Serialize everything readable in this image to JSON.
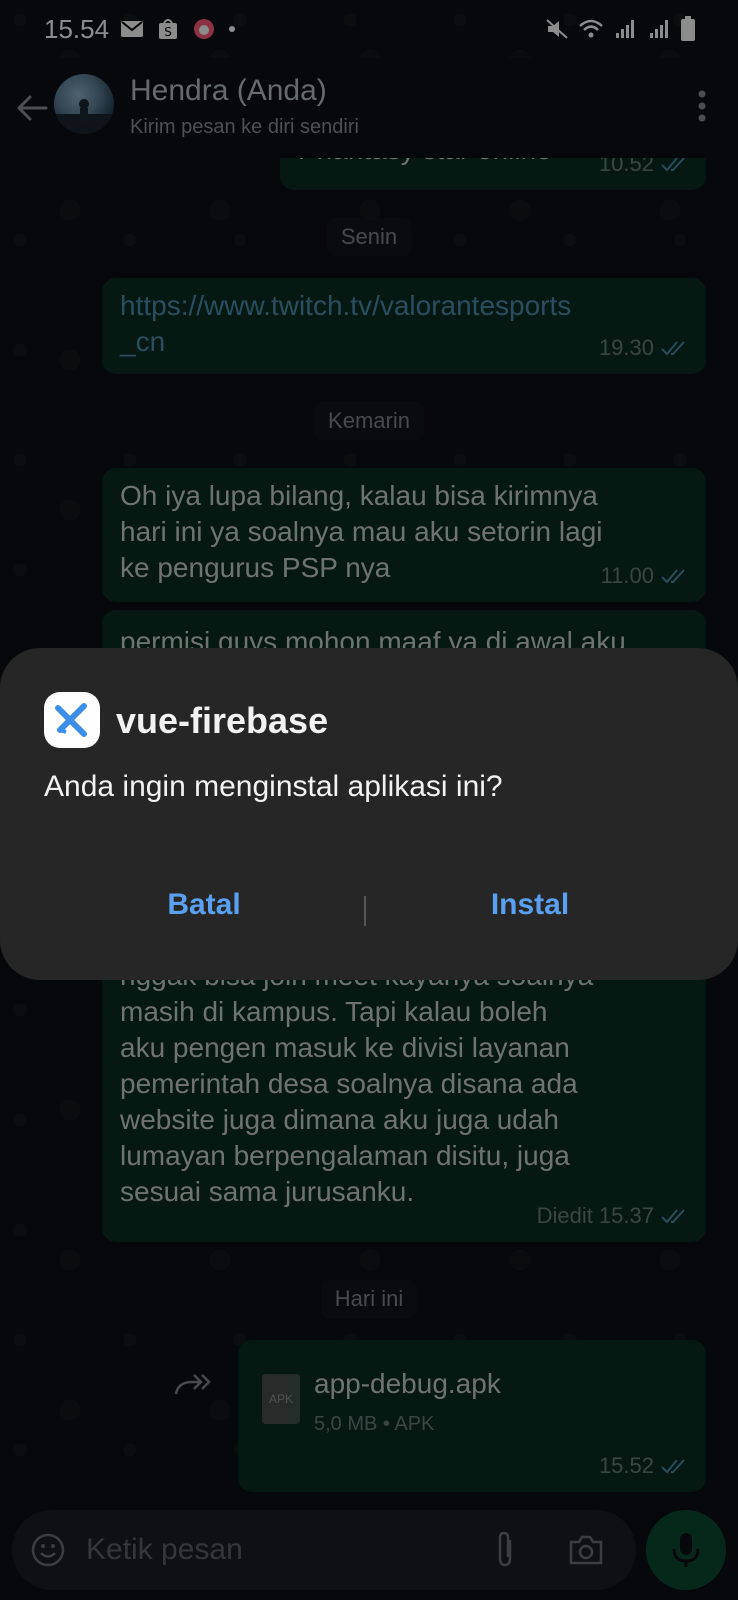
{
  "status_bar": {
    "time": "15.54",
    "notification_icons": [
      "mail-icon",
      "shopee-icon",
      "app-notification-icon",
      "dot-icon"
    ],
    "system_icons": [
      "mute-icon",
      "wifi-icon",
      "signal-icon",
      "signal-icon",
      "battery-icon"
    ]
  },
  "header": {
    "contact_name": "Hendra (Anda)",
    "subtitle": "Kirim pesan ke diri sendiri"
  },
  "messages": {
    "top_partial": {
      "text": "Phantasy star online",
      "time": "10.52"
    },
    "day_senin": "Senin",
    "link": {
      "line1": "https://www.twitch.tv/valorantesports",
      "line2": "_cn",
      "time": "19.30"
    },
    "day_kemarin": "Kemarin",
    "msg1": {
      "line1": "Oh iya lupa bilang, kalau bisa kirimnya",
      "line2": "hari ini ya soalnya mau aku setorin lagi",
      "line3": "ke pengurus PSP nya",
      "time": "11.00"
    },
    "msg2_top": "permisi guys mohon maaf ya di awal aku",
    "msg2_lines": [
      "nggak bisa join meet kayanya soalnya",
      "masih di kampus. Tapi kalau boleh",
      "aku pengen masuk ke divisi layanan",
      "pemerintah desa soalnya disana ada",
      "website juga dimana aku juga udah",
      "lumayan berpengalaman disitu, juga",
      "sesuai sama jurusanku."
    ],
    "msg2_meta": "Diedit 15.37",
    "day_hari_ini": "Hari ini",
    "file": {
      "icon_label": "APK",
      "name": "app-debug.apk",
      "info": "5,0 MB • APK",
      "time": "15.52"
    }
  },
  "input": {
    "placeholder": "Ketik pesan"
  },
  "dialog": {
    "app_name": "vue-firebase",
    "message": "Anda ingin menginstal aplikasi ini?",
    "cancel_label": "Batal",
    "install_label": "Instal"
  },
  "colors": {
    "accent_button": "#5aa0f0",
    "bubble": "#0a2d22",
    "mic": "#0b4a30"
  }
}
